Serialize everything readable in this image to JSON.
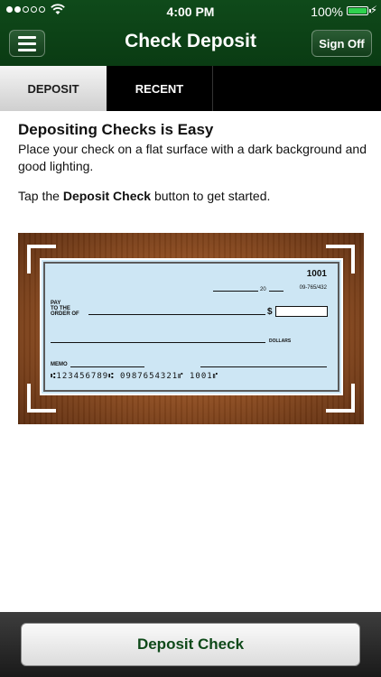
{
  "status_bar": {
    "time": "4:00 PM",
    "battery": "100%",
    "signal_dots": [
      true,
      true,
      false,
      false,
      false
    ],
    "icons": [
      "wifi-icon",
      "battery-icon",
      "charging-bolt-icon"
    ]
  },
  "nav": {
    "title": "Check Deposit",
    "menu_icon": "hamburger-menu-icon",
    "sign_off_label": "Sign Off"
  },
  "tabs": [
    {
      "label": "DEPOSIT",
      "active": true
    },
    {
      "label": "RECENT",
      "active": false
    }
  ],
  "content": {
    "heading": "Depositing Checks is Easy",
    "paragraph1": "Place your check on a flat surface with a dark background and good lighting.",
    "paragraph2_prefix": "Tap the ",
    "paragraph2_bold": "Deposit Check",
    "paragraph2_suffix": " button to get started."
  },
  "check": {
    "number": "1001",
    "routing": "09-765/432",
    "date_suffix": "20",
    "pay_label_line1": "PAY",
    "pay_label_line2": "TO THE",
    "pay_label_line3": "ORDER OF",
    "dollar_sign": "$",
    "dollars_label": "DOLLARS",
    "memo_label": "MEMO",
    "micr_line": "⑆123456789⑆  0987654321⑈  1001⑈"
  },
  "bottom": {
    "deposit_button_label": "Deposit Check"
  },
  "colors": {
    "nav_green": "#0f4a1a",
    "button_text_green": "#0f4a1a",
    "check_blue": "#cde6f4",
    "wood": "#8a4a1f"
  }
}
